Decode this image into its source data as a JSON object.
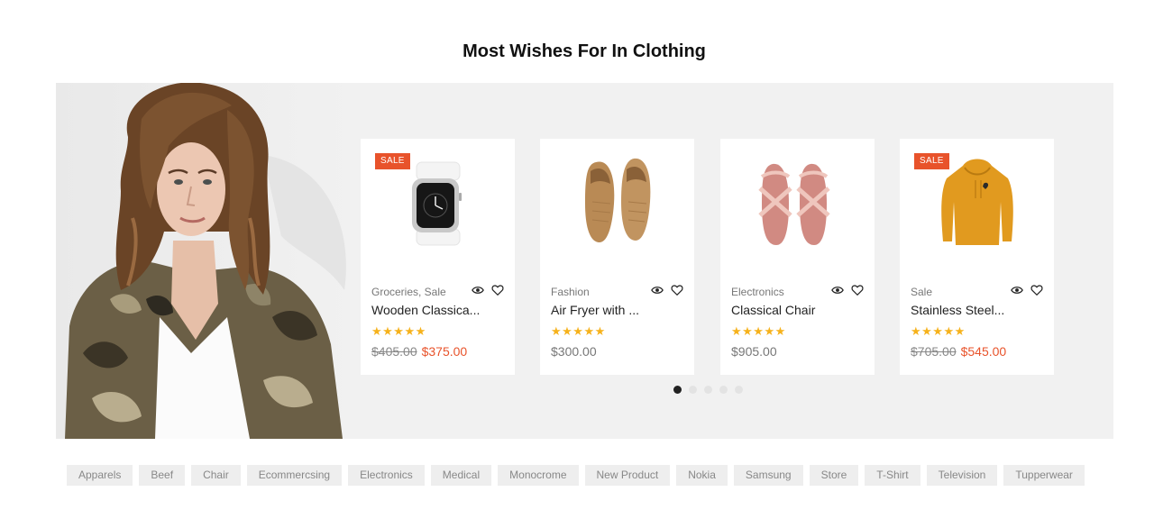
{
  "section": {
    "title": "Most Wishes For In Clothing"
  },
  "products": [
    {
      "category": "Groceries, Sale",
      "name": "Wooden Classica...",
      "rating": 5,
      "sale_badge": "SALE",
      "old_price": "$405.00",
      "price": "$375.00",
      "image": "watch"
    },
    {
      "category": "Fashion",
      "name": "Air Fryer with ...",
      "rating": 5,
      "sale_badge": "",
      "old_price": "",
      "price": "$300.00",
      "image": "loafers"
    },
    {
      "category": "Electronics",
      "name": "Classical Chair",
      "rating": 5,
      "sale_badge": "",
      "old_price": "",
      "price": "$905.00",
      "image": "sandals"
    },
    {
      "category": "Sale",
      "name": "Stainless Steel...",
      "rating": 5,
      "sale_badge": "SALE",
      "old_price": "$705.00",
      "price": "$545.00",
      "image": "hoodie"
    }
  ],
  "stars_text": "★★★★★",
  "icons": {
    "quick_view": "eye-icon",
    "wishlist": "heart-icon"
  },
  "carousel": {
    "pages": 5,
    "active": 0
  },
  "tags": [
    "Apparels",
    "Beef",
    "Chair",
    "Ecommercsing",
    "Electronics",
    "Medical",
    "Monocrome",
    "New Product",
    "Nokia",
    "Samsung",
    "Store",
    "T-Shirt",
    "Television",
    "Tupperwear"
  ],
  "colors": {
    "accent": "#e8532b",
    "star": "#f6b21c",
    "banner_bg": "#f1f1f1",
    "tag_bg": "#eeeeee"
  }
}
